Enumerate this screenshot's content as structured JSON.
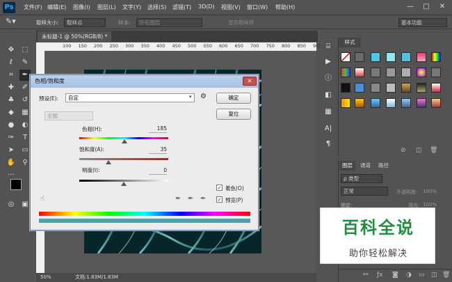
{
  "app": {
    "logo": "Ps"
  },
  "menubar": {
    "items": [
      "文件(F)",
      "编辑(E)",
      "图像(I)",
      "图层(L)",
      "文字(Y)",
      "选择(S)",
      "滤镜(T)",
      "3D(D)",
      "视图(V)",
      "窗口(W)",
      "帮助(H)"
    ],
    "window_controls": [
      "—",
      "□",
      "✕"
    ]
  },
  "optionsbar": {
    "sample_size_label": "取样大小:",
    "sample_size_value": "取样点",
    "sample_label": "样本:",
    "sample_value": "所有图层",
    "show_ring_label": "显示取样环",
    "workspace": "基本功能"
  },
  "document": {
    "tab_title": "未标题-1 @ 50%(RGB/8) *",
    "ruler_ticks": [
      "100",
      "150",
      "200",
      "250",
      "300",
      "350",
      "400",
      "450",
      "500",
      "550",
      "600",
      "650",
      "700",
      "750",
      "800",
      "850",
      "900"
    ],
    "zoom": "50%",
    "doc_info": "文档:1.83M/1.83M"
  },
  "styles_panel": {
    "tab": "样式"
  },
  "layers_panel": {
    "tabs": [
      "图层",
      "通道",
      "路径"
    ],
    "filter_label": "ρ 类型",
    "blend_mode": "正常",
    "opacity_label": "不透明度:",
    "opacity_value": "100%",
    "lock_label": "锁定:",
    "fill_label": "填充:",
    "fill_value": "100%"
  },
  "dialog": {
    "title": "色相/饱和度",
    "preset_label": "预设(E):",
    "preset_value": "自定",
    "channel_value": "全图",
    "ok_button": "确定",
    "reset_button": "复位",
    "hue_label": "色相(H):",
    "hue_value": "185",
    "hue_fraction": 0.51,
    "saturation_label": "饱和度(A):",
    "saturation_value": "35",
    "saturation_fraction": 0.33,
    "lightness_label": "明度(I):",
    "lightness_value": "0",
    "lightness_fraction": 0.5,
    "colorize_label": "着色(O)",
    "colorize_checked": true,
    "preview_label": "预览(P)",
    "preview_checked": true
  },
  "watermark": {
    "line1": "百科全说",
    "line2": "助你轻松解决"
  }
}
